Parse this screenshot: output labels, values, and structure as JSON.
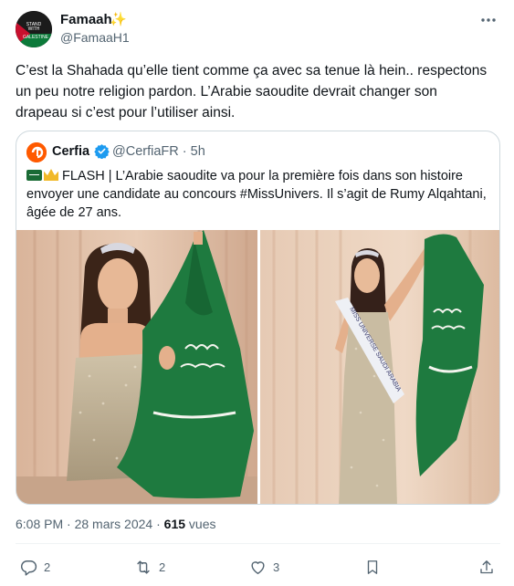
{
  "author": {
    "name": "Famaah",
    "name_emoji": "✨",
    "handle": "@FamaaH1",
    "avatar_text": "STAND WITH GALESTINE",
    "icon": "avatar"
  },
  "more_icon": "more-icon",
  "tweet_text": "C’est la Shahada qu’elle tient comme ça avec sa tenue là hein.. respectons un peu notre religion pardon. L’Arabie saoudite devrait changer son drapeau si c’est pour l’utiliser ainsi.",
  "quote": {
    "name": "Cerfia",
    "verified": true,
    "handle": "@CerfiaFR",
    "separator": "·",
    "time": "5h",
    "text": "FLASH | L’Arabie saoudite va pour la première fois dans son histoire envoyer une candidate au concours #MissUnivers. Il s’agit de Rumy Alqahtani, âgée de 27 ans.",
    "images": [
      "photo-kneeling-with-flag",
      "photo-standing-with-sash-and-flag"
    ],
    "sash_text": "MISS UNIVERSE SAUDI ARABIA"
  },
  "meta": {
    "time": "6:08 PM",
    "separator1": "·",
    "date": "28 mars 2024",
    "separator2": "·",
    "views_count": "615",
    "views_label": "vues"
  },
  "actions": {
    "reply_count": "2",
    "retweet_count": "2",
    "like_count": "3"
  },
  "colors": {
    "text": "#0f1419",
    "secondary": "#536471",
    "border": "#cfd9de",
    "verified": "#1d9bf0",
    "flag_green": "#1a6b35"
  }
}
